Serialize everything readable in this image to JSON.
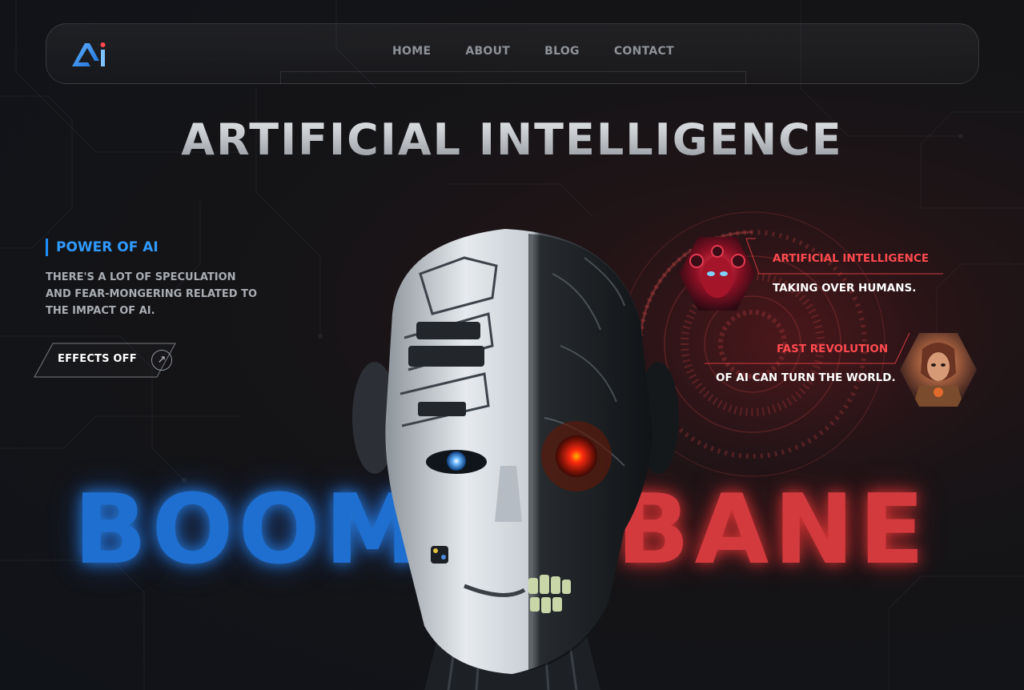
{
  "nav": {
    "logo_text": "Ai",
    "links": [
      "HOME",
      "ABOUT",
      "BLOG",
      "CONTACT"
    ]
  },
  "hero": {
    "title": "ARTIFICIAL INTELLIGENCE"
  },
  "power": {
    "heading": "POWER OF AI",
    "description": "THERE'S A LOT OF SPECULATION AND FEAR-MONGERING RELATED TO THE IMPACT OF AI.",
    "effects_button_label": "EFFECTS OFF",
    "effects_icon": "arrow-circle-icon"
  },
  "big_words": {
    "left": "BOOM",
    "right": "BANE",
    "left_color": "#1f6fd0",
    "right_color": "#d23a3e"
  },
  "cards": [
    {
      "title": "ARTIFICIAL INTELLIGENCE",
      "text": "TAKING OVER HUMANS."
    },
    {
      "title": "FAST REVOLUTION",
      "text": "OF AI CAN TURN THE WORLD."
    }
  ],
  "colors": {
    "accent_blue": "#2f9bff",
    "accent_red": "#ff4a4f",
    "background": "#131519"
  }
}
